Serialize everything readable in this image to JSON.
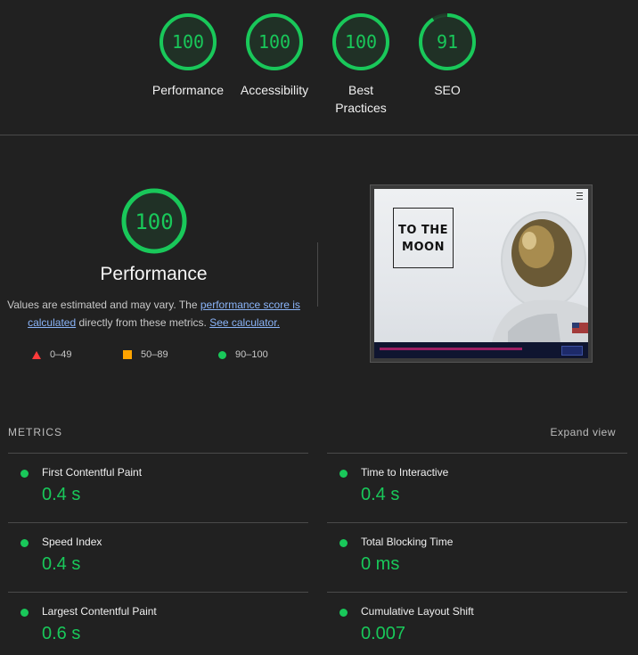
{
  "colors": {
    "pass": "#19c85a",
    "average": "#ffa400",
    "fail": "#ff3b3b",
    "background": "#212121"
  },
  "gauges": [
    {
      "score": "100",
      "label": "Performance",
      "percent": 100
    },
    {
      "score": "100",
      "label": "Accessibility",
      "percent": 100
    },
    {
      "score": "100",
      "label": "Best Practices",
      "percent": 100
    },
    {
      "score": "91",
      "label": "SEO",
      "percent": 91
    }
  ],
  "performance": {
    "score": "100",
    "title": "Performance",
    "desc_prefix": "Values are estimated and may vary. The ",
    "link_score": "performance score is calculated",
    "desc_middle": " directly from these metrics. ",
    "link_calc": "See calculator."
  },
  "legend": [
    {
      "icon": "triangle-icon",
      "range": "0–49"
    },
    {
      "icon": "square-icon",
      "range": "50–89"
    },
    {
      "icon": "circle-icon",
      "range": "90–100"
    }
  ],
  "screenshot": {
    "logo_line1": "TO THE",
    "logo_line2": "MOON"
  },
  "metrics": {
    "title": "METRICS",
    "expand_label": "Expand view",
    "items": [
      {
        "name": "First Contentful Paint",
        "value": "0.4 s"
      },
      {
        "name": "Time to Interactive",
        "value": "0.4 s"
      },
      {
        "name": "Speed Index",
        "value": "0.4 s"
      },
      {
        "name": "Total Blocking Time",
        "value": "0 ms"
      },
      {
        "name": "Largest Contentful Paint",
        "value": "0.6 s"
      },
      {
        "name": "Cumulative Layout Shift",
        "value": "0.007"
      }
    ]
  }
}
